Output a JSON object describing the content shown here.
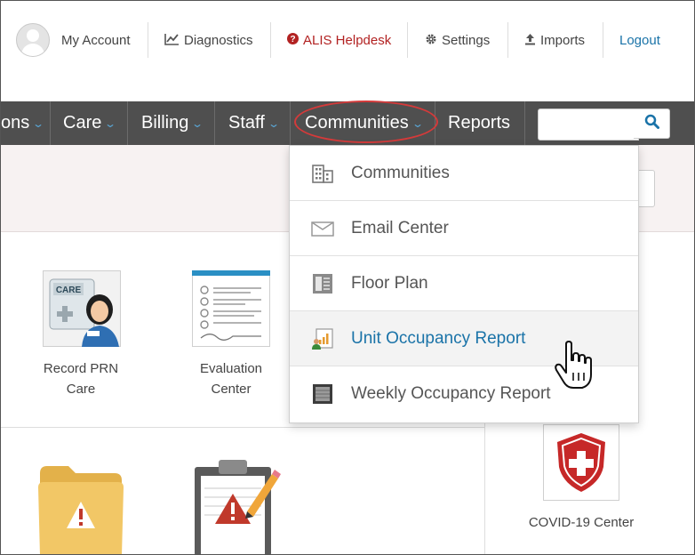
{
  "topbar": {
    "my_account": "My Account",
    "diagnostics": "Diagnostics",
    "helpdesk": "ALIS Helpdesk",
    "settings": "Settings",
    "imports": "Imports",
    "logout": "Logout"
  },
  "nav": {
    "partial_item": "ons",
    "care": "Care",
    "billing": "Billing",
    "staff": "Staff",
    "communities": "Communities",
    "reports": "Reports",
    "search_placeholder": ""
  },
  "dropdown": {
    "items": [
      {
        "label": "Communities",
        "icon": "building-icon"
      },
      {
        "label": "Email Center",
        "icon": "envelope-icon"
      },
      {
        "label": "Floor Plan",
        "icon": "floor-plan-icon"
      },
      {
        "label": "Unit Occupancy Report",
        "icon": "occupancy-report-icon",
        "hovered": true
      },
      {
        "label": "Weekly Occupancy Report",
        "icon": "weekly-report-icon"
      }
    ]
  },
  "tiles": {
    "record_prn_care_line1": "Record PRN",
    "record_prn_care_line2": "Care",
    "care_badge": "CARE",
    "evaluation_center_line1": "Evaluation",
    "evaluation_center_line2": "Center",
    "covid_center": "COVID-19 Center"
  },
  "colors": {
    "nav_bg": "#4f4f4f",
    "link_blue": "#1a73a8",
    "helpdesk_red": "#b22222",
    "annotation_red": "#d43a3a"
  }
}
